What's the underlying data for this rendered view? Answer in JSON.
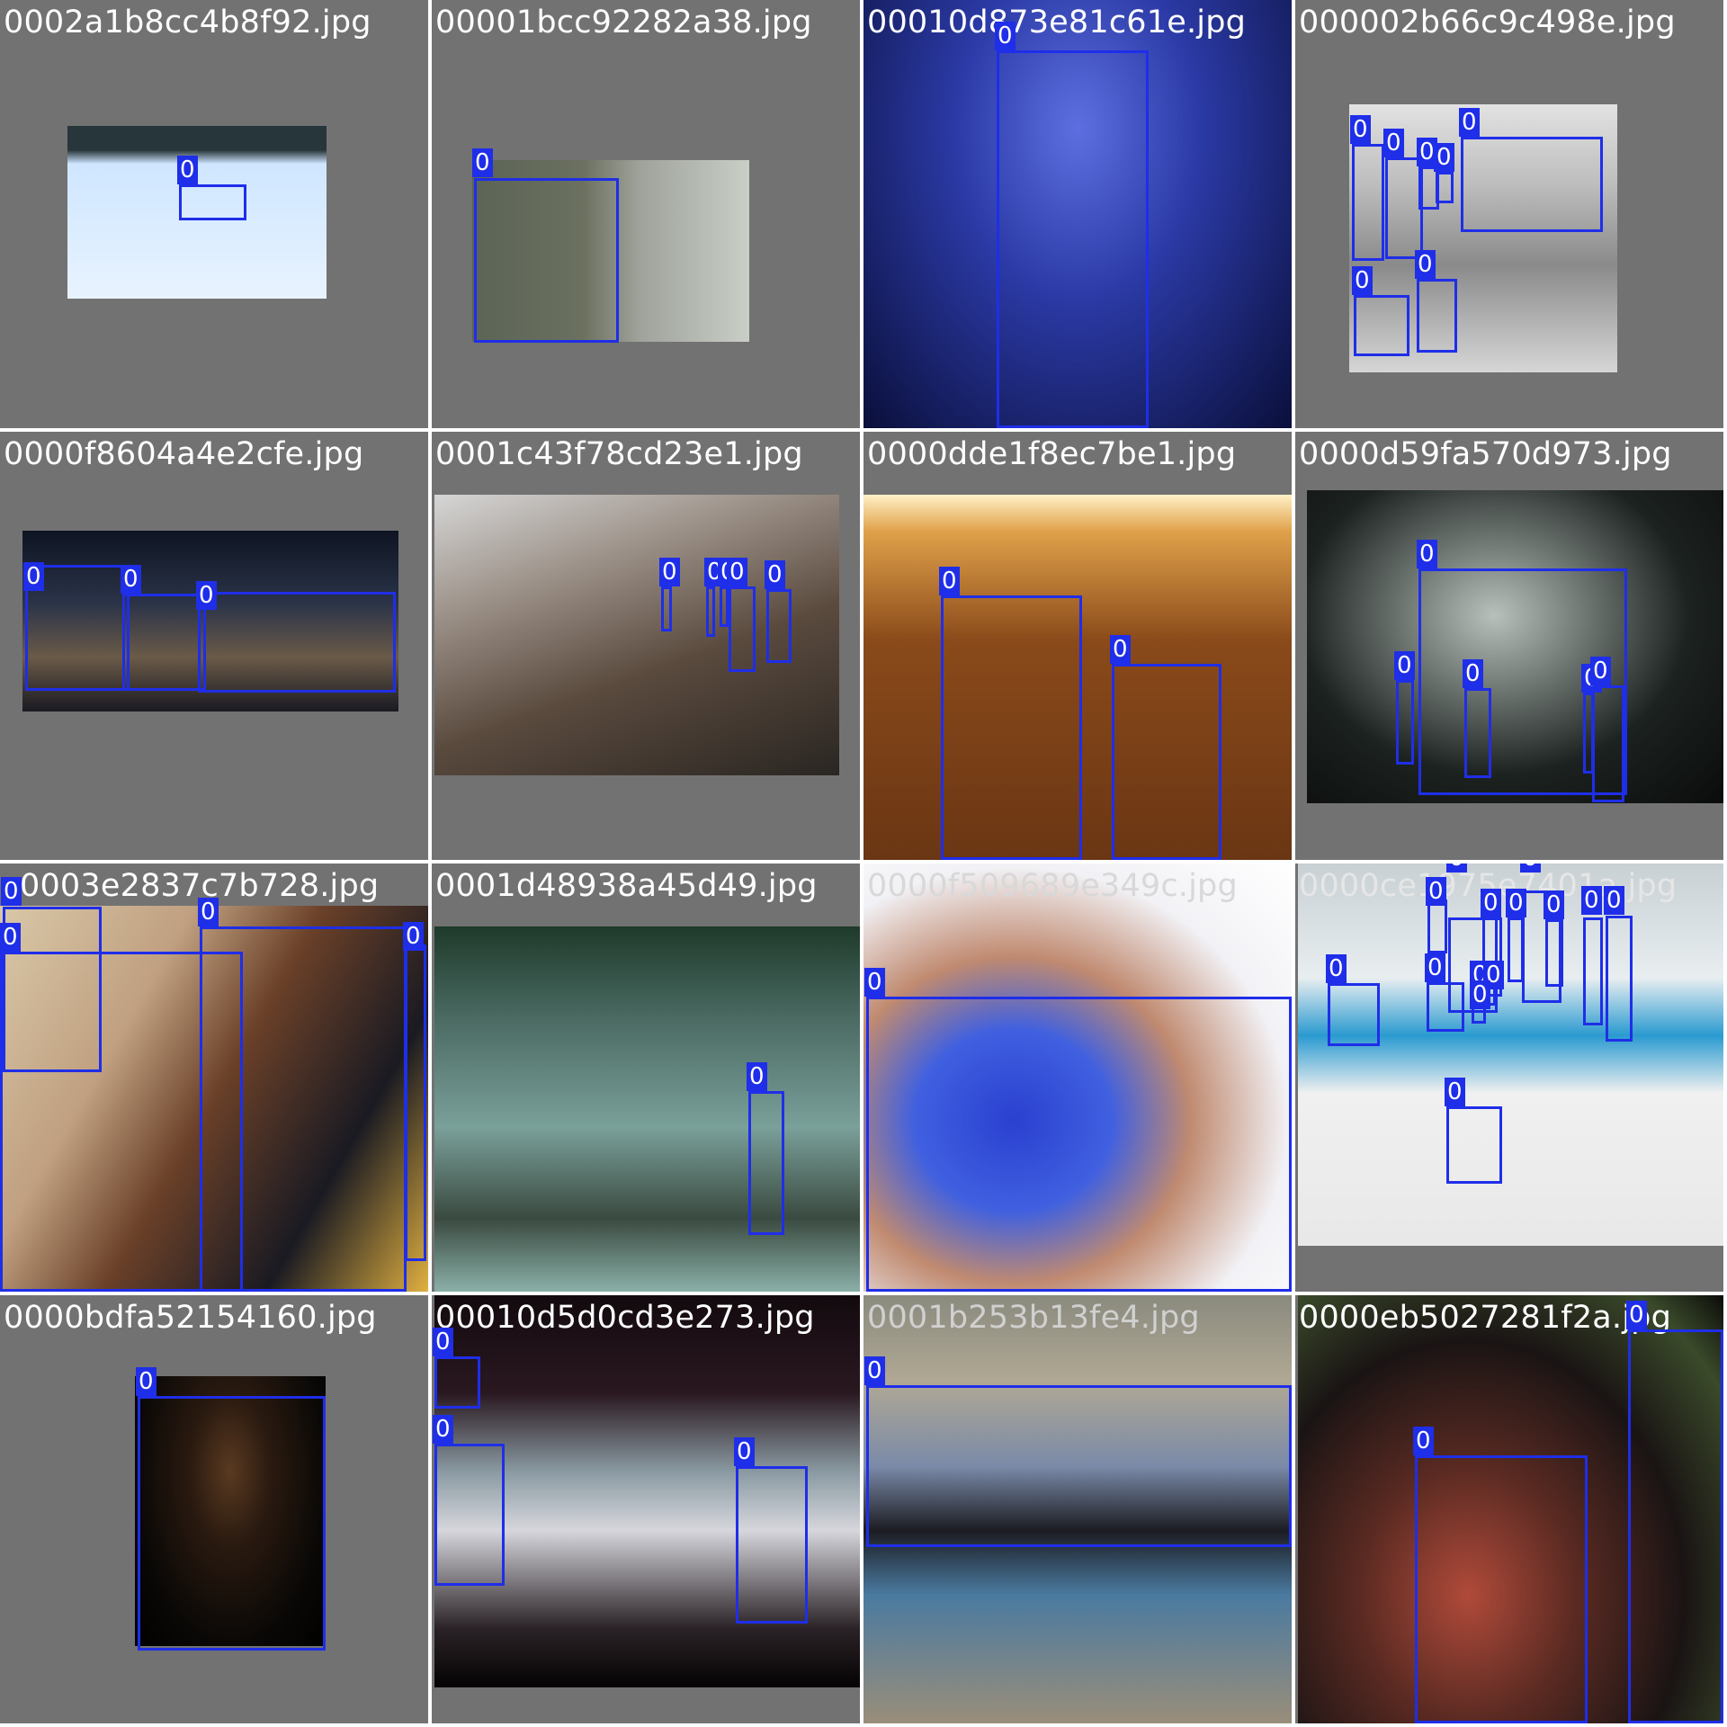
{
  "grid": {
    "tiles": [
      {
        "filename": "0002a1b8cc4b8f92.jpg",
        "label": "0"
      },
      {
        "filename": "00001bcc92282a38.jpg",
        "label": "0"
      },
      {
        "filename": "00010d873e81c61e.jpg",
        "label": "0"
      },
      {
        "filename": "000002b66c9c498e.jpg",
        "label": "0"
      },
      {
        "filename": "0000f8604a4e2cfe.jpg",
        "label": "0"
      },
      {
        "filename": "0001c43f78cd23e1.jpg",
        "label": "0"
      },
      {
        "filename": "0000dde1f8ec7be1.jpg",
        "label": "0"
      },
      {
        "filename": "0000d59fa570d973.jpg",
        "label": "0"
      },
      {
        "filename": "0003e2837c7b728.jpg",
        "label": "0"
      },
      {
        "filename": "0001d48938a45d49.jpg",
        "label": "0"
      },
      {
        "filename": "0000f509689e349c.jpg",
        "label": "0"
      },
      {
        "filename": "0000ce1975e7401a.jpg",
        "label": "0"
      },
      {
        "filename": "0000bdfa52154160.jpg",
        "label": "0"
      },
      {
        "filename": "00010d5d0cd3e273.jpg",
        "label": "0"
      },
      {
        "filename": "0001b253b13fe4.jpg",
        "label": "0"
      },
      {
        "filename": "0000eb5027281f2a.jpg",
        "label": "0"
      }
    ]
  },
  "colors": {
    "box": "#1f2ee8",
    "background": "#727272"
  }
}
